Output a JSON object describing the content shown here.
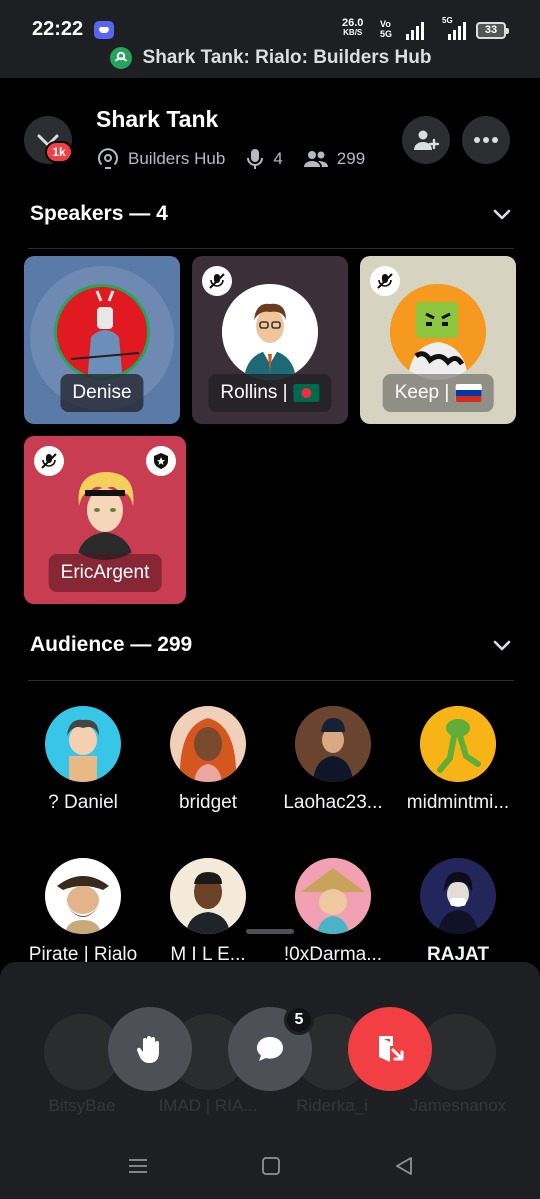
{
  "status_bar": {
    "time": "22:22",
    "net_speed": "26.0",
    "net_speed_unit": "KB/S",
    "volte": "Vo 5G",
    "signal_label": "5G",
    "battery": "33"
  },
  "live_banner": "Shark Tank: Rialo: Builders Hub",
  "header": {
    "title": "Shark Tank",
    "channel": "Builders Hub",
    "speaker_count": "4",
    "listener_count": "299",
    "notification_badge": "1k"
  },
  "speakers": {
    "heading": "Speakers — 4",
    "items": [
      {
        "name": "Denise",
        "muted": false,
        "flag": ""
      },
      {
        "name": "Rollins |",
        "muted": true,
        "flag": "bd"
      },
      {
        "name": "Keep |",
        "muted": true,
        "flag": "ru"
      },
      {
        "name": "EricArgent",
        "muted": true,
        "moderator": true,
        "flag": ""
      }
    ]
  },
  "audience": {
    "heading": "Audience — 299",
    "items": [
      {
        "name": "? Daniel"
      },
      {
        "name": "bridget"
      },
      {
        "name": "Laohac23..."
      },
      {
        "name": "midmintmi..."
      },
      {
        "name": "Pirate | Rialo"
      },
      {
        "name": "M I L E..."
      },
      {
        "name": "!0xDarma..."
      },
      {
        "name": "RAJAT"
      }
    ],
    "behind_sheet": [
      {
        "name": "BitsyBae"
      },
      {
        "name": "IMAD | RIA..."
      },
      {
        "name": "Riderka_i"
      },
      {
        "name": "Jamesnanox"
      }
    ]
  },
  "actions": {
    "message_count": "5"
  },
  "colors": {
    "leave_red": "#f23f43",
    "surface": "#1e1f22",
    "button_gray": "#4e5058"
  }
}
